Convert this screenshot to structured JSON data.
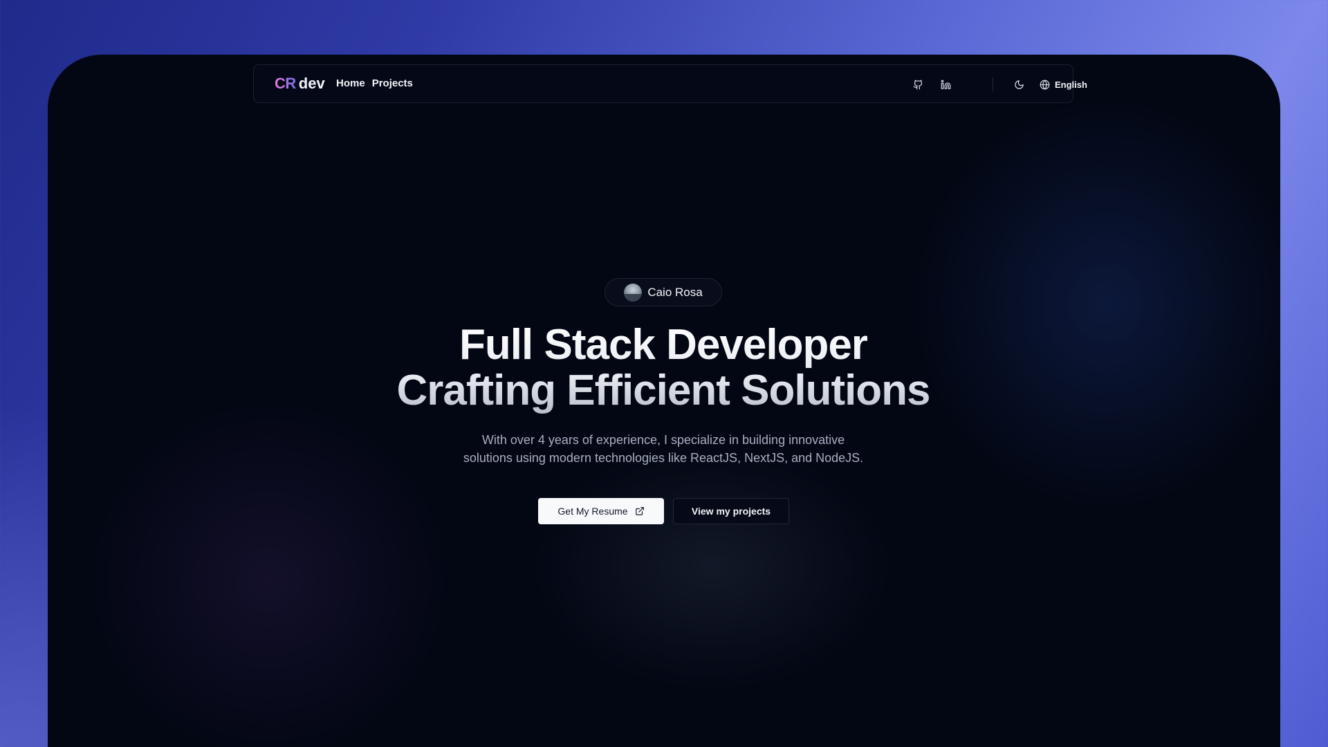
{
  "brand": {
    "logo_mark": "CR",
    "logo_suffix": "dev"
  },
  "nav": {
    "links": [
      {
        "label": "Home"
      },
      {
        "label": "Projects"
      }
    ],
    "icons": [
      "github-icon",
      "linkedin-icon",
      "moon-icon",
      "globe-icon"
    ],
    "language_label": "English"
  },
  "hero": {
    "badge_name": "Caio Rosa",
    "title_line1": "Full Stack Developer",
    "title_line2": "Crafting Efficient Solutions",
    "subtitle_line1": "With over 4 years of experience, I specialize in building innovative",
    "subtitle_line2": "solutions using modern technologies like ReactJS, NextJS, and NodeJS.",
    "primary_button": "Get My Resume",
    "secondary_button": "View my projects"
  },
  "colors": {
    "background_gradient_start": "#1f2a8a",
    "background_gradient_end": "#7c88ea",
    "screen_background": "#030714",
    "logo_gradient_start": "#e07bd0",
    "logo_gradient_end": "#7a6cf0",
    "primary_button_bg": "#f8f9fb"
  }
}
